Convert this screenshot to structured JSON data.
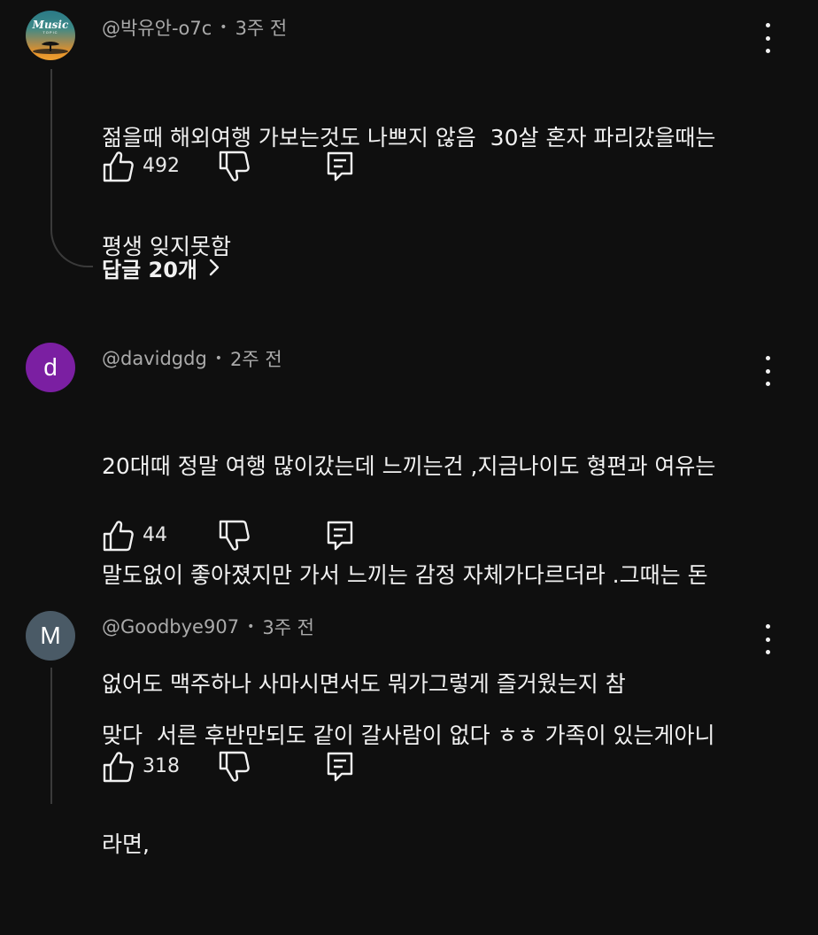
{
  "comments": [
    {
      "author": "@박유안-o7c",
      "time": "3주 전",
      "avatar_text": "Music",
      "avatar_sub": "TOPIC",
      "lines": [
        "젊을때 해외여행 가보는것도 나쁘지 않음  30살 혼자 파리갔을때는",
        "평생 잊지못함"
      ],
      "likes": "492",
      "replies_label": "답글 20개"
    },
    {
      "author": "@davidgdg",
      "time": "2주 전",
      "avatar_letter": "d",
      "lines": [
        "20대때 정말 여행 많이갔는데 느끼는건 ,지금나이도 형편과 여유는",
        "말도없이 좋아졌지만 가서 느끼는 감정 자체가다르더라 .그때는 돈",
        "없어도 맥주하나 사마시면서도 뭐가그렇게 즐거웠는지 참"
      ],
      "likes": "44"
    },
    {
      "author": "@Goodbye907",
      "time": "3주 전",
      "avatar_letter": "M",
      "lines": [
        "맞다  서른 후반만되도 같이 갈사람이 없다 ㅎㅎ 가족이 있는게아니",
        "라면,"
      ],
      "likes": "318"
    }
  ],
  "icons": {
    "like": "thumbs-up-icon",
    "dislike": "thumbs-down-icon",
    "reply": "reply-icon",
    "more": "more-vertical-icon",
    "chevron": "chevron-right-icon"
  },
  "colors": {
    "background": "#0f0f0f",
    "text": "#f1f1f1",
    "meta": "#aaaaaa",
    "avatar_d": "#7b1fa2",
    "avatar_m": "#4a5a66"
  }
}
